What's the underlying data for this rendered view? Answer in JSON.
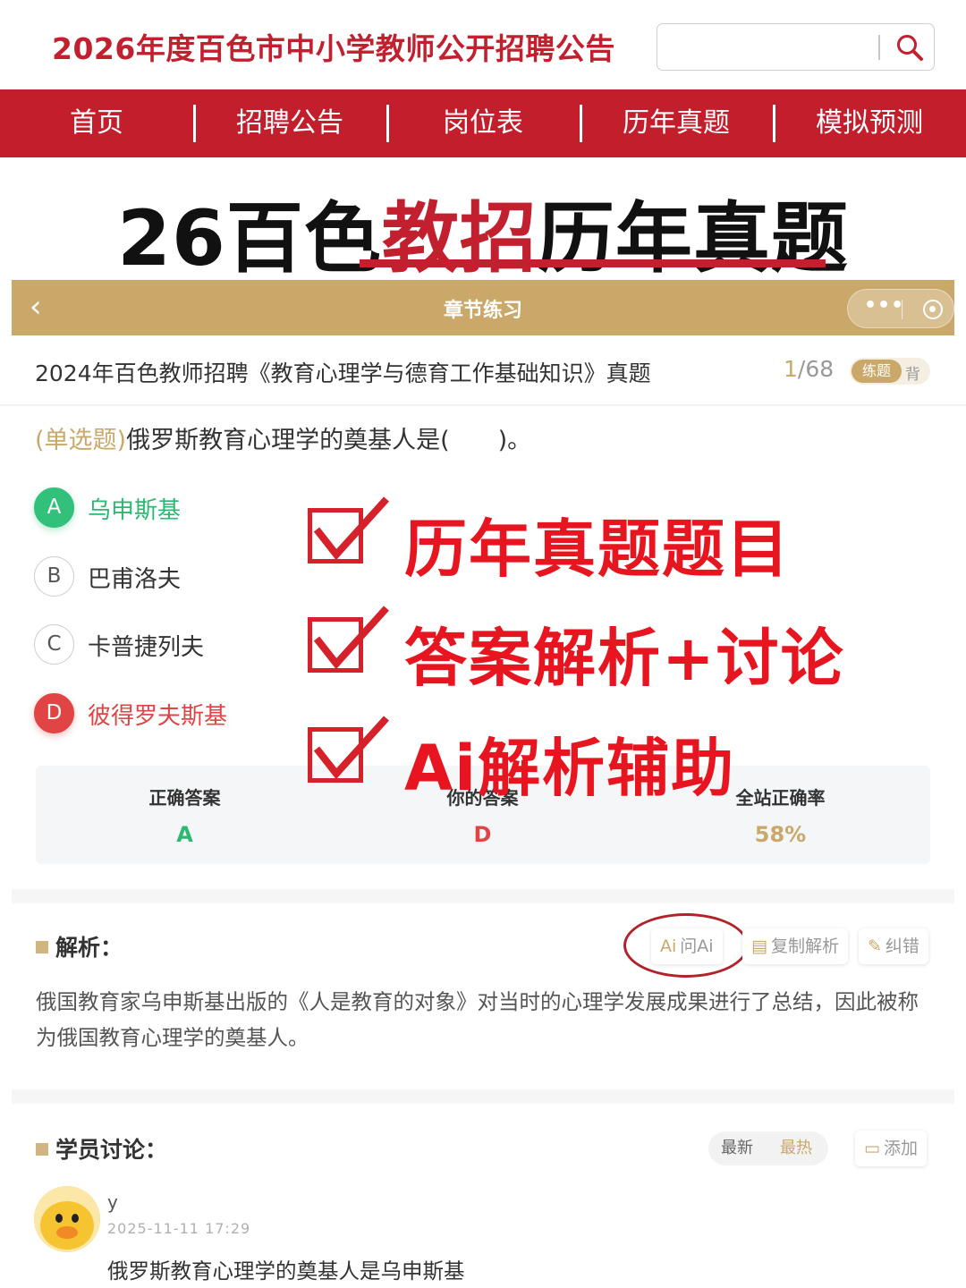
{
  "header": {
    "site_title": "2026年度百色市中小学教师公开招聘公告",
    "search_placeholder": ""
  },
  "nav": [
    "首页",
    "招聘公告",
    "岗位表",
    "历年真题",
    "模拟预测"
  ],
  "headline": {
    "part1": "26百色",
    "part2": "教招",
    "part3": "历年真题"
  },
  "chapter_bar": {
    "back": "‹",
    "title": "章节练习"
  },
  "exam": {
    "title": "2024年百色教师招聘《教育心理学与德育工作基础知识》真题",
    "current": "1",
    "total": "/68",
    "mode_active": "练题",
    "mode_alt": "背"
  },
  "question": {
    "type_tag": "(单选题)",
    "text": "俄罗斯教育心理学的奠基人是(　　)。",
    "options": [
      {
        "letter": "A",
        "text": "乌申斯基",
        "state": "correct"
      },
      {
        "letter": "B",
        "text": "巴甫洛夫",
        "state": "normal"
      },
      {
        "letter": "C",
        "text": "卡普捷列夫",
        "state": "normal"
      },
      {
        "letter": "D",
        "text": "彼得罗夫斯基",
        "state": "wrong"
      }
    ]
  },
  "promo": [
    "历年真题题目",
    "答案解析+讨论",
    "Ai解析辅助"
  ],
  "stats": [
    {
      "label": "正确答案",
      "value": "A",
      "color": "#2cb871"
    },
    {
      "label": "你的答案",
      "value": "D",
      "color": "#e04444"
    },
    {
      "label": "全站正确率",
      "value": "58%",
      "color": "#c9a86a"
    }
  ],
  "analysis": {
    "heading": "解析：",
    "ask_ai": "问Ai",
    "ask_ai_prefix": "Ai",
    "copy": "复制解析",
    "report": "纠错",
    "text": "俄国教育家乌申斯基出版的《人是教育的对象》对当时的心理学发展成果进行了总结，因此被称为俄国教育心理学的奠基人。"
  },
  "discussion": {
    "heading": "学员讨论：",
    "sort_latest": "最新",
    "sort_hot": "最热",
    "add": "添加",
    "comments": [
      {
        "user": "y",
        "time": "2025-11-11 17:29",
        "text": "俄罗斯教育心理学的奠基人是乌申斯基"
      }
    ]
  }
}
